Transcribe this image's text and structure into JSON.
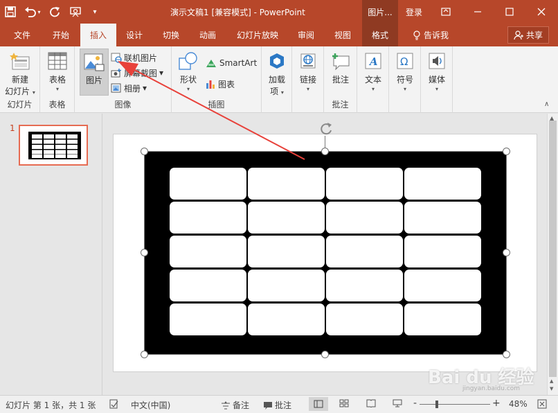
{
  "titlebar": {
    "title": "演示文稿1 [兼容模式] - PowerPoint",
    "context_tab": "图片...",
    "login": "登录",
    "qat_caret": "▾"
  },
  "tabs": [
    {
      "label": "文件"
    },
    {
      "label": "开始"
    },
    {
      "label": "插入"
    },
    {
      "label": "设计"
    },
    {
      "label": "切换"
    },
    {
      "label": "动画"
    },
    {
      "label": "幻灯片放映"
    },
    {
      "label": "审阅"
    },
    {
      "label": "视图"
    },
    {
      "label": "格式"
    }
  ],
  "tell_me": "告诉我",
  "share": "共享",
  "ribbon": {
    "new_slide": "新建",
    "new_slide_2": "幻灯片",
    "group_slides": "幻灯片",
    "table": "表格",
    "group_table": "表格",
    "picture": "图片",
    "online_picture": "联机图片",
    "screenshot": "屏幕截图",
    "album": "相册",
    "group_images": "图像",
    "shapes": "形状",
    "smartart": "SmartArt",
    "chart": "图表",
    "group_illustrations": "插图",
    "addins": "加载",
    "addins_2": "项",
    "link": "链接",
    "comment": "批注",
    "group_comments": "批注",
    "text": "文本",
    "symbol": "符号",
    "media": "媒体",
    "caret": "▾",
    "collapse": "∧"
  },
  "thumbnails": {
    "slide_number": "1"
  },
  "statusbar": {
    "slide_info": "幻灯片 第 1 张，共 1 张",
    "language": "中文(中国)",
    "notes": "备注",
    "comments": "批注",
    "zoom_minus": "-",
    "zoom_plus": "+",
    "zoom": "48%"
  },
  "watermark": {
    "brand": "Bai du 经验",
    "url": "jingyan.baidu.com"
  },
  "colors": {
    "accent": "#b7472a",
    "accent_dark": "#8f3a22",
    "arrow": "#e8413a"
  }
}
